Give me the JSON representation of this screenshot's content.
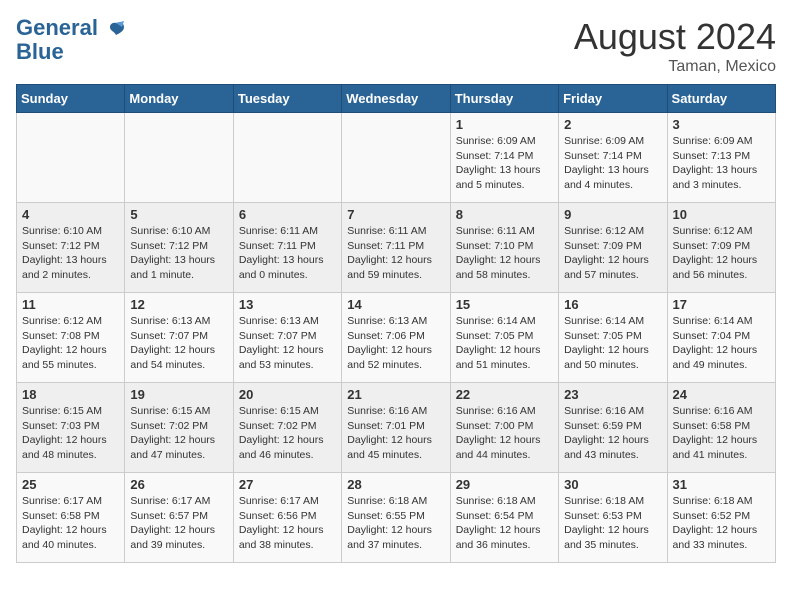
{
  "header": {
    "logo_line1": "General",
    "logo_line2": "Blue",
    "month": "August 2024",
    "location": "Taman, Mexico"
  },
  "days_of_week": [
    "Sunday",
    "Monday",
    "Tuesday",
    "Wednesday",
    "Thursday",
    "Friday",
    "Saturday"
  ],
  "weeks": [
    [
      {
        "day": "",
        "info": ""
      },
      {
        "day": "",
        "info": ""
      },
      {
        "day": "",
        "info": ""
      },
      {
        "day": "",
        "info": ""
      },
      {
        "day": "1",
        "info": "Sunrise: 6:09 AM\nSunset: 7:14 PM\nDaylight: 13 hours\nand 5 minutes."
      },
      {
        "day": "2",
        "info": "Sunrise: 6:09 AM\nSunset: 7:14 PM\nDaylight: 13 hours\nand 4 minutes."
      },
      {
        "day": "3",
        "info": "Sunrise: 6:09 AM\nSunset: 7:13 PM\nDaylight: 13 hours\nand 3 minutes."
      }
    ],
    [
      {
        "day": "4",
        "info": "Sunrise: 6:10 AM\nSunset: 7:12 PM\nDaylight: 13 hours\nand 2 minutes."
      },
      {
        "day": "5",
        "info": "Sunrise: 6:10 AM\nSunset: 7:12 PM\nDaylight: 13 hours\nand 1 minute."
      },
      {
        "day": "6",
        "info": "Sunrise: 6:11 AM\nSunset: 7:11 PM\nDaylight: 13 hours\nand 0 minutes."
      },
      {
        "day": "7",
        "info": "Sunrise: 6:11 AM\nSunset: 7:11 PM\nDaylight: 12 hours\nand 59 minutes."
      },
      {
        "day": "8",
        "info": "Sunrise: 6:11 AM\nSunset: 7:10 PM\nDaylight: 12 hours\nand 58 minutes."
      },
      {
        "day": "9",
        "info": "Sunrise: 6:12 AM\nSunset: 7:09 PM\nDaylight: 12 hours\nand 57 minutes."
      },
      {
        "day": "10",
        "info": "Sunrise: 6:12 AM\nSunset: 7:09 PM\nDaylight: 12 hours\nand 56 minutes."
      }
    ],
    [
      {
        "day": "11",
        "info": "Sunrise: 6:12 AM\nSunset: 7:08 PM\nDaylight: 12 hours\nand 55 minutes."
      },
      {
        "day": "12",
        "info": "Sunrise: 6:13 AM\nSunset: 7:07 PM\nDaylight: 12 hours\nand 54 minutes."
      },
      {
        "day": "13",
        "info": "Sunrise: 6:13 AM\nSunset: 7:07 PM\nDaylight: 12 hours\nand 53 minutes."
      },
      {
        "day": "14",
        "info": "Sunrise: 6:13 AM\nSunset: 7:06 PM\nDaylight: 12 hours\nand 52 minutes."
      },
      {
        "day": "15",
        "info": "Sunrise: 6:14 AM\nSunset: 7:05 PM\nDaylight: 12 hours\nand 51 minutes."
      },
      {
        "day": "16",
        "info": "Sunrise: 6:14 AM\nSunset: 7:05 PM\nDaylight: 12 hours\nand 50 minutes."
      },
      {
        "day": "17",
        "info": "Sunrise: 6:14 AM\nSunset: 7:04 PM\nDaylight: 12 hours\nand 49 minutes."
      }
    ],
    [
      {
        "day": "18",
        "info": "Sunrise: 6:15 AM\nSunset: 7:03 PM\nDaylight: 12 hours\nand 48 minutes."
      },
      {
        "day": "19",
        "info": "Sunrise: 6:15 AM\nSunset: 7:02 PM\nDaylight: 12 hours\nand 47 minutes."
      },
      {
        "day": "20",
        "info": "Sunrise: 6:15 AM\nSunset: 7:02 PM\nDaylight: 12 hours\nand 46 minutes."
      },
      {
        "day": "21",
        "info": "Sunrise: 6:16 AM\nSunset: 7:01 PM\nDaylight: 12 hours\nand 45 minutes."
      },
      {
        "day": "22",
        "info": "Sunrise: 6:16 AM\nSunset: 7:00 PM\nDaylight: 12 hours\nand 44 minutes."
      },
      {
        "day": "23",
        "info": "Sunrise: 6:16 AM\nSunset: 6:59 PM\nDaylight: 12 hours\nand 43 minutes."
      },
      {
        "day": "24",
        "info": "Sunrise: 6:16 AM\nSunset: 6:58 PM\nDaylight: 12 hours\nand 41 minutes."
      }
    ],
    [
      {
        "day": "25",
        "info": "Sunrise: 6:17 AM\nSunset: 6:58 PM\nDaylight: 12 hours\nand 40 minutes."
      },
      {
        "day": "26",
        "info": "Sunrise: 6:17 AM\nSunset: 6:57 PM\nDaylight: 12 hours\nand 39 minutes."
      },
      {
        "day": "27",
        "info": "Sunrise: 6:17 AM\nSunset: 6:56 PM\nDaylight: 12 hours\nand 38 minutes."
      },
      {
        "day": "28",
        "info": "Sunrise: 6:18 AM\nSunset: 6:55 PM\nDaylight: 12 hours\nand 37 minutes."
      },
      {
        "day": "29",
        "info": "Sunrise: 6:18 AM\nSunset: 6:54 PM\nDaylight: 12 hours\nand 36 minutes."
      },
      {
        "day": "30",
        "info": "Sunrise: 6:18 AM\nSunset: 6:53 PM\nDaylight: 12 hours\nand 35 minutes."
      },
      {
        "day": "31",
        "info": "Sunrise: 6:18 AM\nSunset: 6:52 PM\nDaylight: 12 hours\nand 33 minutes."
      }
    ]
  ]
}
